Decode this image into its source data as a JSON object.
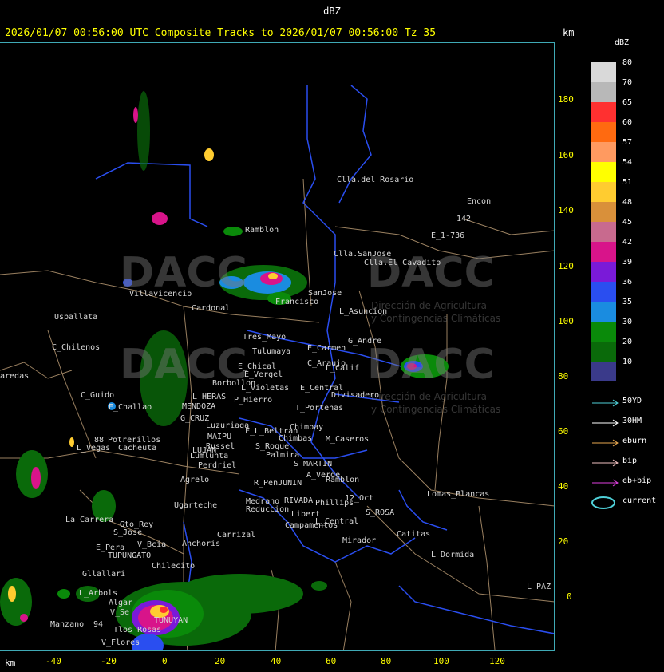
{
  "window": {
    "title": "dBZ"
  },
  "header": {
    "text": "2026/01/07 00:56:00 UTC Composite Tracks to 2026/01/07 00:56:00 Tz 35",
    "km_label": "km"
  },
  "axes": {
    "y_ticks": [
      "180",
      "160",
      "140",
      "120",
      "100",
      "80",
      "60",
      "40",
      "20",
      "0"
    ],
    "x_ticks": [
      "-40",
      "-20",
      "0",
      "20",
      "40",
      "60",
      "80",
      "100",
      "120"
    ],
    "x_unit": "km"
  },
  "legend": {
    "title": "dBZ",
    "scale": [
      {
        "label": "80",
        "color": "#d9d9d9"
      },
      {
        "label": "70",
        "color": "#b8b8b8"
      },
      {
        "label": "65",
        "color": "#ff3030"
      },
      {
        "label": "60",
        "color": "#ff6a10"
      },
      {
        "label": "57",
        "color": "#ff9a60"
      },
      {
        "label": "54",
        "color": "#ffff00"
      },
      {
        "label": "51",
        "color": "#ffcc30"
      },
      {
        "label": "48",
        "color": "#d9903a"
      },
      {
        "label": "45",
        "color": "#c86a8e"
      },
      {
        "label": "42",
        "color": "#d8148a"
      },
      {
        "label": "39",
        "color": "#7a1ad8"
      },
      {
        "label": "36",
        "color": "#2a4ef0"
      },
      {
        "label": "35",
        "color": "#1a8ce0"
      },
      {
        "label": "30",
        "color": "#0a8a0a"
      },
      {
        "label": "20",
        "color": "#0a6a0a"
      },
      {
        "label": "10",
        "color": "#3a3a8a"
      }
    ],
    "tracks": [
      {
        "label": "50YD",
        "color": "#4fd0d8"
      },
      {
        "label": "30HM",
        "color": "#ffffff"
      },
      {
        "label": "eburn",
        "color": "#e8a850"
      },
      {
        "label": "bip",
        "color": "#f0c0c0"
      },
      {
        "label": "eb+bip",
        "color": "#e040e0"
      },
      {
        "label": "current",
        "color": "#4fd0d8"
      }
    ]
  },
  "places": [
    {
      "name": "Clla.del_Rosario"
    },
    {
      "name": "Encon"
    },
    {
      "name": "E_1-736"
    },
    {
      "name": "142"
    },
    {
      "name": "Ramblon"
    },
    {
      "name": "Clla.SanJose"
    },
    {
      "name": "Clla.El_Cavadito"
    },
    {
      "name": "Villavicencio"
    },
    {
      "name": "Cardonal"
    },
    {
      "name": "Francisco"
    },
    {
      "name": "SanJose"
    },
    {
      "name": "L_Asuncion"
    },
    {
      "name": "Uspallata"
    },
    {
      "name": "C_Chilenos"
    },
    {
      "name": "Tres_Mayo"
    },
    {
      "name": "Tulumaya"
    },
    {
      "name": "E_Carmen"
    },
    {
      "name": "G_Andre"
    },
    {
      "name": "E_Chical"
    },
    {
      "name": "E_Vergel"
    },
    {
      "name": "C_Araujo"
    },
    {
      "name": "L_Calif"
    },
    {
      "name": "Borbollon"
    },
    {
      "name": "L_Violetas"
    },
    {
      "name": "E_Central"
    },
    {
      "name": "Divisadero"
    },
    {
      "name": "aredas"
    },
    {
      "name": "C_Guido"
    },
    {
      "name": "L_HERAS"
    },
    {
      "name": "P_Hierro"
    },
    {
      "name": "E_Challao"
    },
    {
      "name": "MENDOZA"
    },
    {
      "name": "T_Portenas"
    },
    {
      "name": "G_CRUZ"
    },
    {
      "name": "Luzuriaga"
    },
    {
      "name": "F_L_Beltran"
    },
    {
      "name": "Chimbay"
    },
    {
      "name": "Chimbas"
    },
    {
      "name": "M_Caseros"
    },
    {
      "name": "88"
    },
    {
      "name": "Potrerillos"
    },
    {
      "name": "L_Vegas"
    },
    {
      "name": "Cacheuta"
    },
    {
      "name": "MAIPU"
    },
    {
      "name": "Russel"
    },
    {
      "name": "S_Roque"
    },
    {
      "name": "Palmira"
    },
    {
      "name": "LUJAN"
    },
    {
      "name": "Lumlunta"
    },
    {
      "name": "S_MARTIN"
    },
    {
      "name": "Perdriel"
    },
    {
      "name": "A_Verde"
    },
    {
      "name": "Agrelo"
    },
    {
      "name": "R_PenJUNIN"
    },
    {
      "name": "Ramblon"
    },
    {
      "name": "Lomas_Blancas"
    },
    {
      "name": "Ugarteche"
    },
    {
      "name": "Medrano"
    },
    {
      "name": "RIVADA"
    },
    {
      "name": "Phillips"
    },
    {
      "name": "12_Oct"
    },
    {
      "name": "Reduccion"
    },
    {
      "name": "S_ROSA"
    },
    {
      "name": "La_Carrera"
    },
    {
      "name": "Gto_Rey"
    },
    {
      "name": "S_Jose"
    },
    {
      "name": "Libert"
    },
    {
      "name": "L_Central"
    },
    {
      "name": "Catitas"
    },
    {
      "name": "Carrizal"
    },
    {
      "name": "Campamentos"
    },
    {
      "name": "Mirador"
    },
    {
      "name": "E_Pera"
    },
    {
      "name": "V_Bcia"
    },
    {
      "name": "Anchoris"
    },
    {
      "name": "L_Dormida"
    },
    {
      "name": "TUPUNGATO"
    },
    {
      "name": "Chilecito"
    },
    {
      "name": "Gllallari"
    },
    {
      "name": "L_Arbols"
    },
    {
      "name": "Algar"
    },
    {
      "name": "V_Se"
    },
    {
      "name": "TUNUYAN"
    },
    {
      "name": "Manzano"
    },
    {
      "name": "94"
    },
    {
      "name": "Tlos_Rosas"
    },
    {
      "name": "V_Flores"
    },
    {
      "name": "L_PAZ"
    }
  ],
  "watermark": {
    "text": "DACC",
    "subtitle_1": "Dirección de Agricultura",
    "subtitle_2": "y Contingencias Climáticas"
  }
}
